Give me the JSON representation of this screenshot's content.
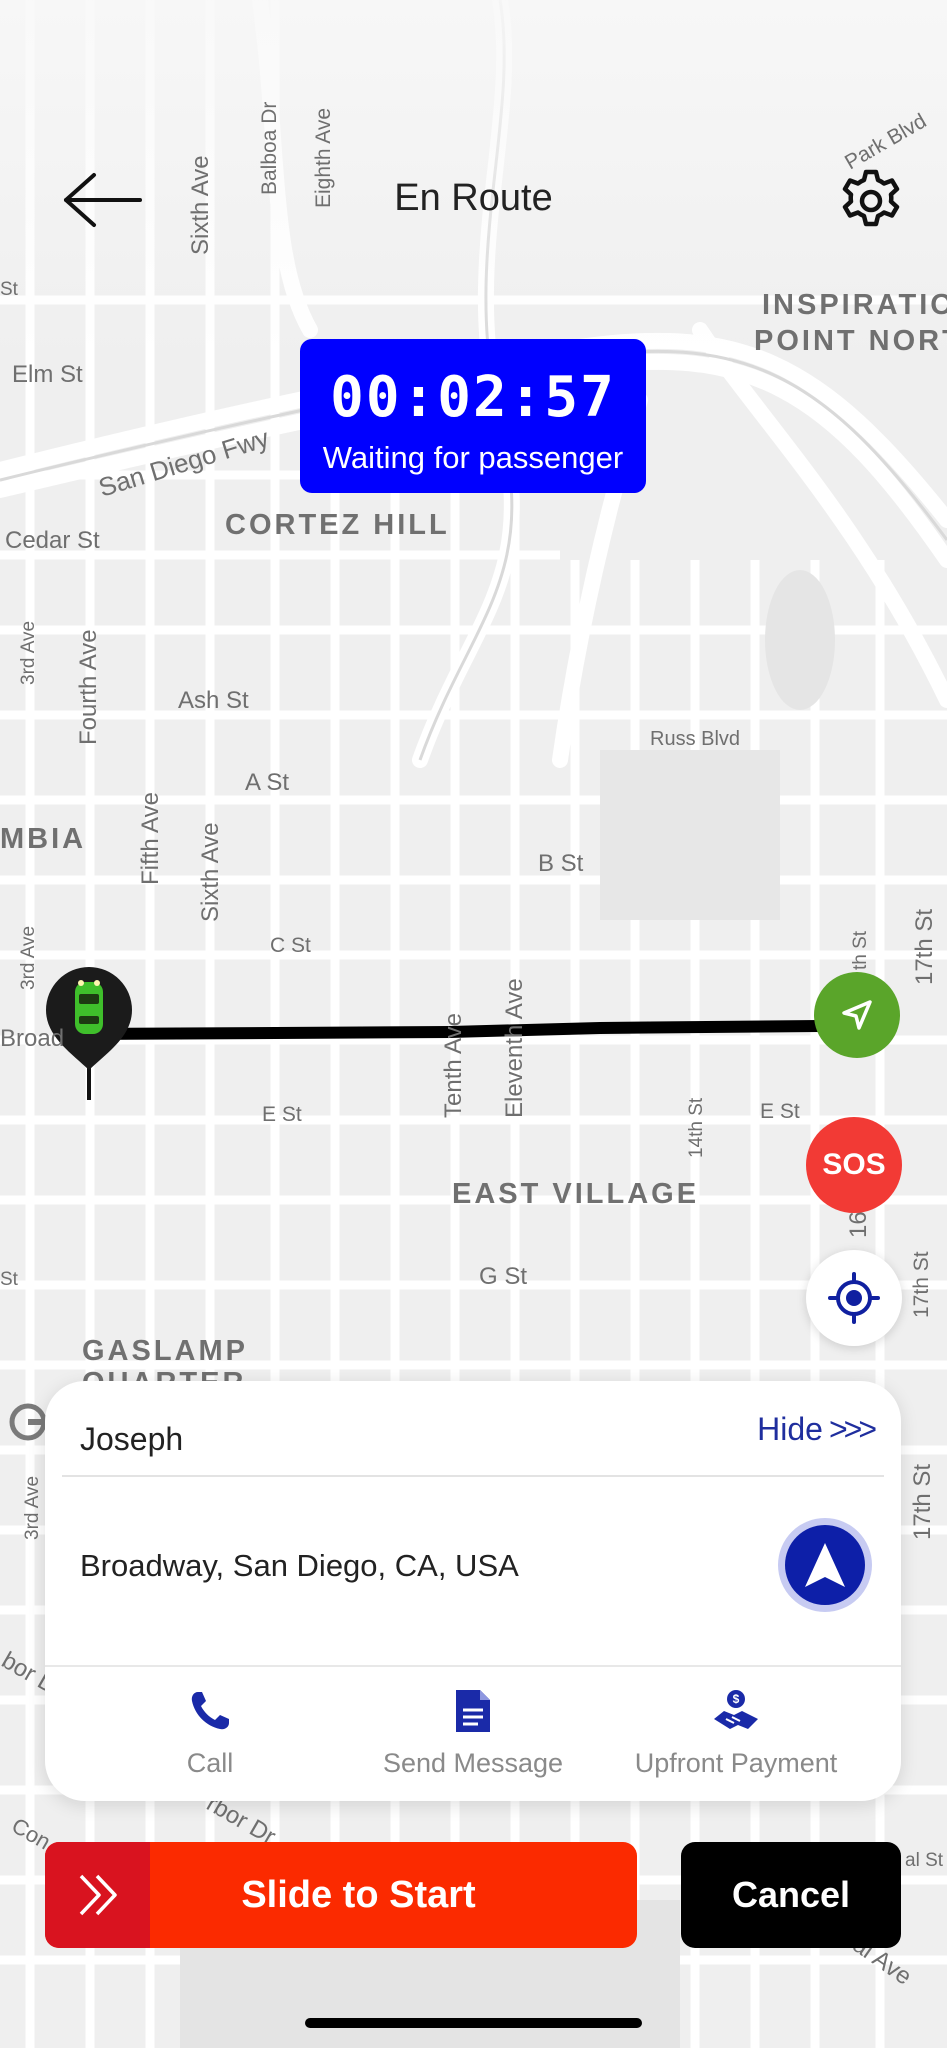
{
  "header": {
    "title": "En Route"
  },
  "timer": {
    "time": "00:02:57",
    "status": "Waiting for passenger"
  },
  "map": {
    "area_labels": [
      "CORTEZ HILL",
      "EAST VILLAGE",
      "GASLAMP",
      "QUARTER",
      "INSPIRATIO",
      "POINT NORT",
      "MBIA"
    ],
    "street_labels": [
      "Sixth Ave",
      "Balboa Dr",
      "Eighth Ave",
      "Park Blvd",
      "Elm St",
      "San Diego Fwy",
      "Cedar St",
      "3rd Ave",
      "Fourth Ave",
      "Ash St",
      "Fifth Ave",
      "A St",
      "Sixth Ave",
      "Russ Blvd",
      "B St",
      "C St",
      "3rd Ave",
      "Broad",
      "Tenth Ave",
      "Eleventh Ave",
      "E St",
      "14th St",
      "E St",
      "G St",
      "17th St",
      "17th St",
      "16",
      "17th St",
      "th St",
      "3rd Ave",
      "bor D",
      "rbor Dr",
      "ional Ave",
      "St",
      "St",
      "Con",
      "al St"
    ]
  },
  "sos": {
    "label": "SOS"
  },
  "passenger": {
    "name": "Joseph",
    "hide_label": "Hide",
    "hide_chevrons": ">>>",
    "address": "Broadway, San Diego, CA, USA"
  },
  "actions": [
    {
      "label": "Call",
      "icon": "phone-icon"
    },
    {
      "label": "Send Message",
      "icon": "document-icon"
    },
    {
      "label": "Upfront Payment",
      "icon": "payment-handshake-icon"
    }
  ],
  "footer": {
    "slide_label": "Slide to Start",
    "cancel_label": "Cancel"
  },
  "colors": {
    "timer_bg": "#0000ff",
    "slide_bg": "#fb2a00",
    "slide_handle": "#d9131f",
    "nav_fab": "#5aa52a",
    "sos": "#f23a35",
    "accent_blue": "#0d1fa8"
  }
}
